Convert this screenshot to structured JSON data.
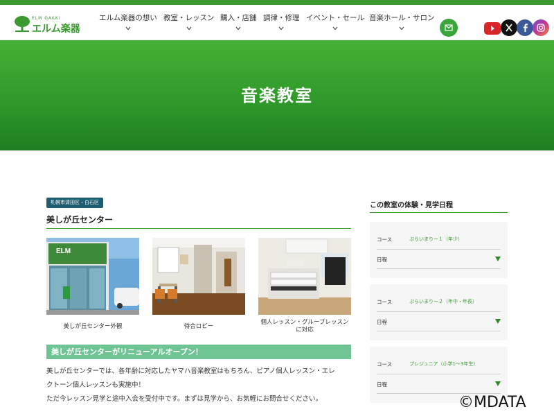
{
  "header": {
    "logo_sub": "ELM GAKKI",
    "logo_text": "エルム楽器",
    "nav": [
      {
        "label": "エルム楽器の想い"
      },
      {
        "label": "教室・レッスン"
      },
      {
        "label": "購入・店舗"
      },
      {
        "label": "調律・修理"
      },
      {
        "label": "イベント・セール"
      },
      {
        "label": "音楽ホール・サロン"
      }
    ],
    "icons": [
      "mail-icon",
      "youtube-icon",
      "x-icon",
      "facebook-icon",
      "instagram-icon"
    ]
  },
  "hero": {
    "title": "音楽教室"
  },
  "main": {
    "tag": "札幌市清田区・白石区",
    "center_title": "美しが丘センター",
    "photos": [
      {
        "caption": "美しが丘センター外観"
      },
      {
        "caption": "待合ロビー"
      },
      {
        "caption": "個人レッスン・グループレッスンに対応"
      }
    ],
    "banner": "美しが丘センターがリニューアルオープン！",
    "paragraph": [
      "美しが丘センターでは、各年齢に対応したヤマハ音楽教室はもちろん、ピアノ個人レッスン・エレ",
      "クトーン個人レッスンも実施中！",
      "ただ今レッスン見学と途中入会を受付中です。まずは見学から、お気軽にお問合せください。"
    ]
  },
  "sidebar": {
    "title": "この教室の体験・見学日程",
    "course_label": "コース",
    "schedule_label": "日程",
    "courses": [
      {
        "name": "ぷらいまりー１（年少）"
      },
      {
        "name": "ぷらいまりー２（年中・年長）"
      },
      {
        "name": "プレジュニア（小学1〜3年生）"
      }
    ]
  },
  "watermark": "©MDATA",
  "colors": {
    "brand_green": "#3a9a30",
    "banner_green": "#6fc493",
    "tag_blue": "#1e5e70"
  }
}
